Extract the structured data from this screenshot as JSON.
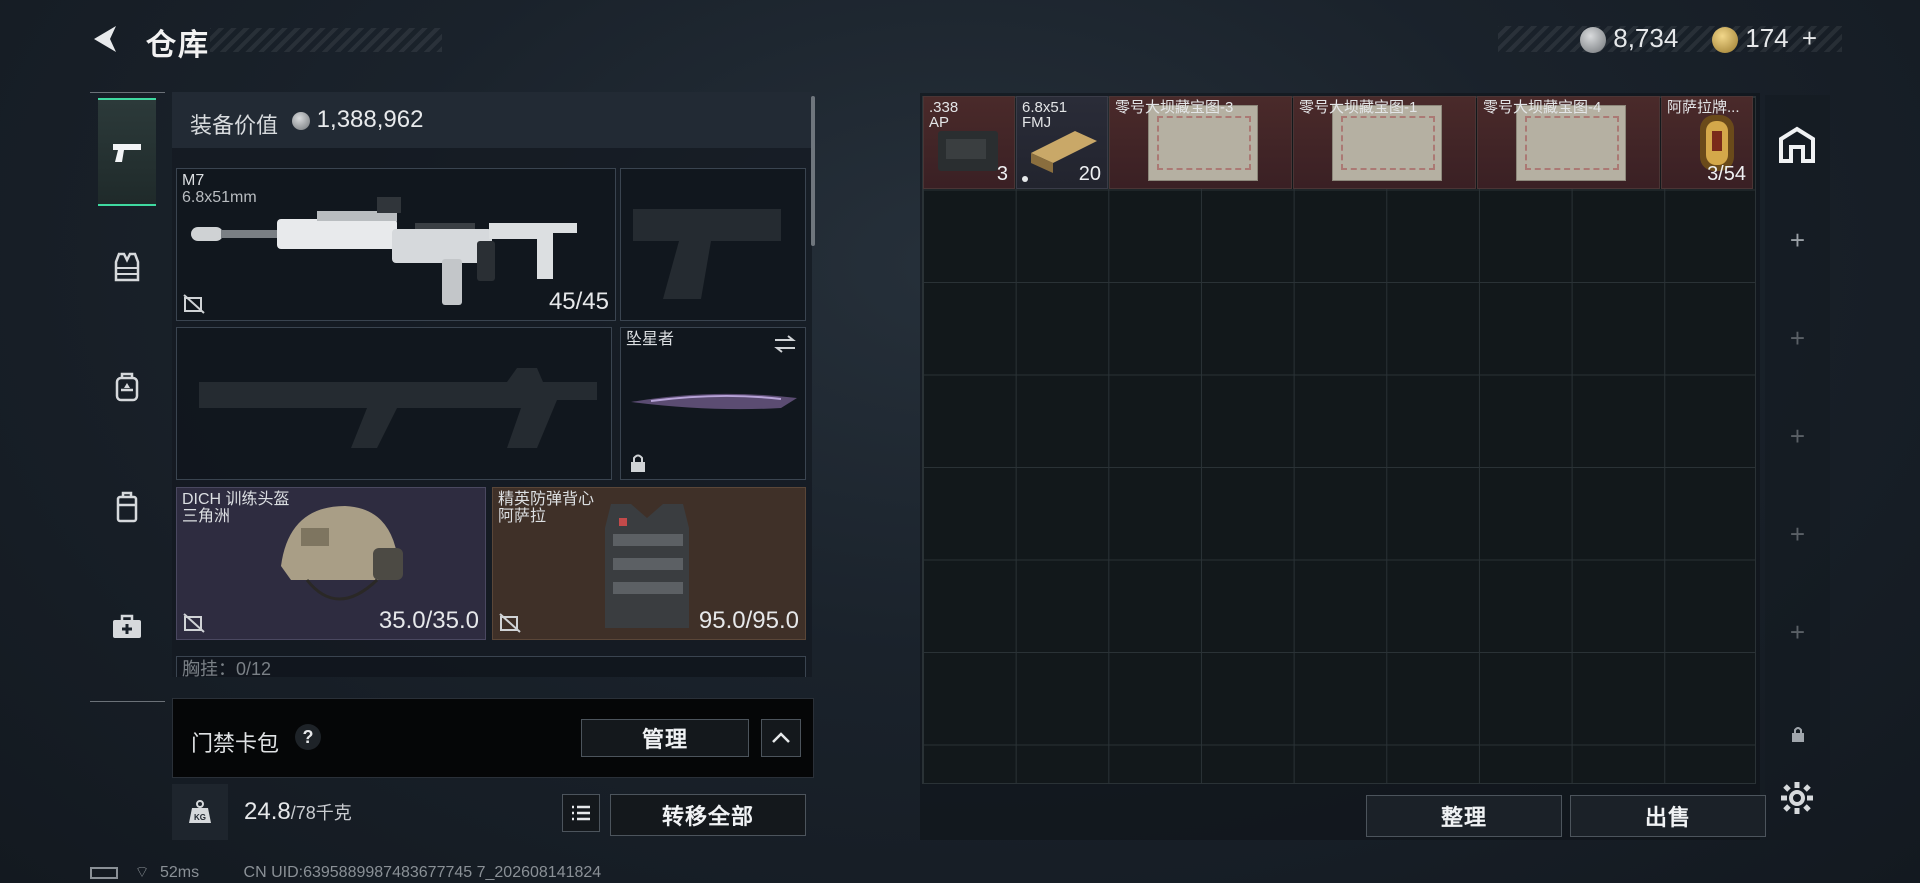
{
  "header": {
    "title": "仓库",
    "currency1": "8,734",
    "currency2": "174",
    "add": "+"
  },
  "equipment": {
    "value_label": "装备价值",
    "value": "1,388,962",
    "primary": {
      "name": "M7",
      "caliber": "6.8x51mm",
      "ammo": "45/45"
    },
    "melee": {
      "name": "坠星者"
    },
    "helmet": {
      "name": "DICH 训练头盔",
      "maker": "三角洲",
      "durability": "35.0/35.0"
    },
    "armor": {
      "name": "精英防弹背心",
      "maker": "阿萨拉",
      "durability": "95.0/95.0"
    },
    "chest_rig": "胸挂：0/12"
  },
  "cardbag": {
    "label": "门禁卡包",
    "help": "?",
    "manage": "管理"
  },
  "weight": {
    "current": "24.8",
    "max": "/78千克",
    "icon": "KG"
  },
  "storage": {
    "items": [
      {
        "name": ".338\nAP",
        "count": "3"
      },
      {
        "name": "6.8x51\nFMJ",
        "count": "20"
      },
      {
        "name": "零号大坝藏宝图-3",
        "count": ""
      },
      {
        "name": "零号大坝藏宝图-1",
        "count": ""
      },
      {
        "name": "零号大坝藏宝图-4",
        "count": ""
      },
      {
        "name": "阿萨拉牌...",
        "count": "3/54"
      }
    ]
  },
  "buttons": {
    "transfer_all": "转移全部",
    "sort": "整理",
    "sell": "出售"
  },
  "status": {
    "ping": "52ms",
    "uid": "CN UID:6395889987483677745 7_202608141824"
  },
  "colors": {
    "accent": "#3fd9a0",
    "item_bg": "#4a2a2a",
    "grid_line": "#2a3236"
  }
}
